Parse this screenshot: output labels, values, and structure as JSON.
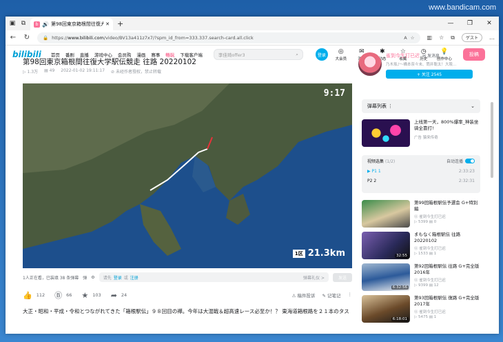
{
  "watermark": "www.bandicam.com",
  "tab": {
    "title": "第98回東京箱根間往復大学",
    "close": "✕"
  },
  "window_controls": [
    "—",
    "❐",
    "✕"
  ],
  "address": {
    "prefix": "https://",
    "domain": "www.bilibili.com",
    "path": "/video/BV13a411z7x7/?spm_id_from=333.337.search-card.all.click"
  },
  "guest_label": "ゲスト",
  "header": {
    "logo": "bilibili",
    "nav": [
      "首页",
      "番剧",
      "直播",
      "游戏中心",
      "会员购",
      "漫画",
      "赛事",
      "畅玩",
      "下载客户端"
    ],
    "search_placeholder": "李佳琦offer3",
    "login": "登录",
    "right": [
      {
        "icon": "◎",
        "label": "大会员"
      },
      {
        "icon": "✉",
        "label": "消息"
      },
      {
        "icon": "✱",
        "label": "动态"
      },
      {
        "icon": "☆",
        "label": "收藏"
      },
      {
        "icon": "◷",
        "label": "历史"
      },
      {
        "icon": "💡",
        "label": "创作中心"
      }
    ],
    "upload": "投稿"
  },
  "video": {
    "title": "第98回東京箱根間往復大学駅伝競走 往路 20220102",
    "views": "1.3万",
    "danmaku": "49",
    "date": "2022-01-02 19:11:17",
    "notice": "未经作者授权，禁止转载",
    "clock": "9:17",
    "section": "1区",
    "distance": "21.3km"
  },
  "danmaku_bar": {
    "watching": "1人正在看，已装填 38 条弹幕",
    "prompt": "请先",
    "login": "登录",
    "or": "或",
    "register": "注册",
    "etiquette": "弹幕礼仪 >",
    "send": "发送"
  },
  "actions": {
    "like": "112",
    "coin": "66",
    "fav": "103",
    "share": "24",
    "report": "稿件投诉",
    "note": "记笔记"
  },
  "description": "大正・昭和・平成・令和とつながれてきた「箱根駅伝」９８回目の襷。今年は大混戦＆超高速レース必至か！？ 東海道箱根路を２１本のタス",
  "uploader": {
    "name": "雀到今生打已迟",
    "message": "发消息",
    "signature": "乃木坂♪～橋本奈々未、筒井聡太！大阪...",
    "follow": "+ 关注 2545"
  },
  "danmaku_list": "弹幕列表",
  "ad": {
    "title": "上线第一天，800%爆率_神装坐骑全靠打!",
    "source": "广告 猿来传奇"
  },
  "playlist": {
    "title": "视频选集",
    "count": "(1/2)",
    "autoplay": "自动连播",
    "items": [
      {
        "label": "P1  1",
        "dur": "2:33:23"
      },
      {
        "label": "P2  2",
        "dur": "2:32:31"
      }
    ]
  },
  "recommend": [
    {
      "title": "第99回箱根駅伝予選会 G+特別編",
      "up": "雀到今生打已迟",
      "views": "5399",
      "danmaku": "0",
      "dur": ""
    },
    {
      "title": "まもなく箱根駅伝 往路 20220102",
      "up": "雀到今生打已迟",
      "views": "1533",
      "danmaku": "1",
      "dur": "32:55"
    },
    {
      "title": "第92回箱根駅伝 往路 G+完全版 2016年",
      "up": "雀到今生打已迟",
      "views": "9399",
      "danmaku": "12",
      "dur": "6:32:56"
    },
    {
      "title": "第93回箱根駅伝 復路 G+完全版 2017年",
      "up": "雀到今生打已迟",
      "views": "5475",
      "danmaku": "1",
      "dur": "6:18:01"
    }
  ]
}
